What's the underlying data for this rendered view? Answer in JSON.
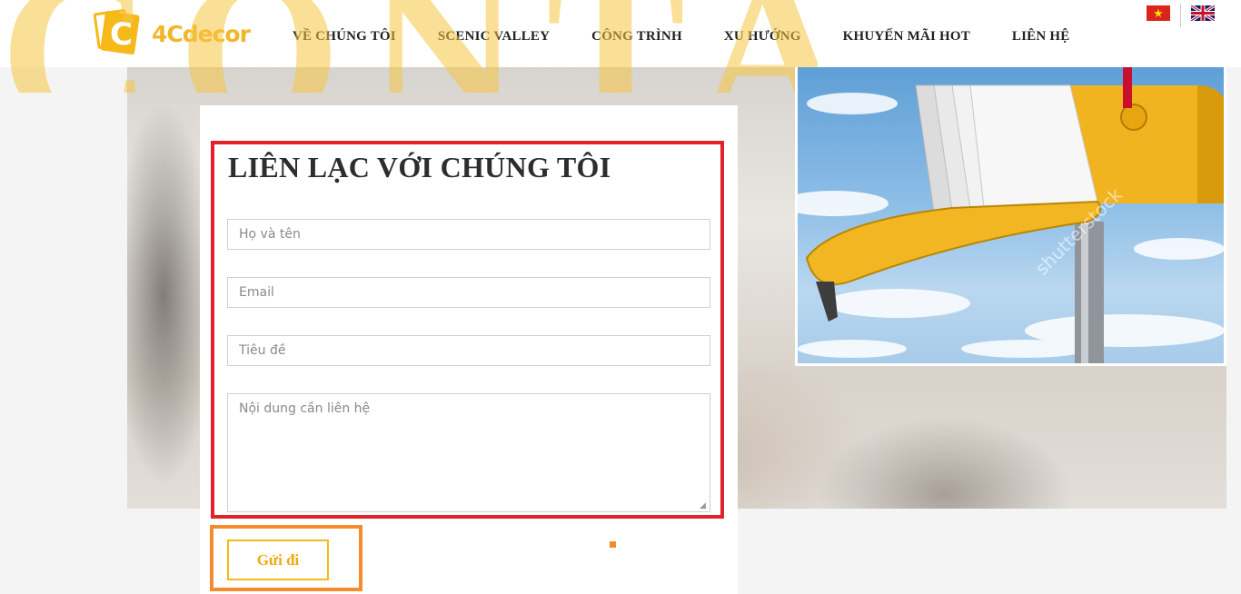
{
  "header": {
    "logo_text": "4Cdecor",
    "logo_letter": "C",
    "nav": [
      "VỀ CHÚNG TÔI",
      "SCENIC VALLEY",
      "CÔNG TRÌNH",
      "XU HƯỚNG",
      "KHUYẾN MÃI HOT",
      "LIÊN HỆ"
    ],
    "languages": [
      "vietnamese-flag-icon",
      "uk-flag-icon"
    ]
  },
  "background_text": "CONTA",
  "contact_form": {
    "title": "LIÊN LẠC VỚI CHÚNG TÔI",
    "name_placeholder": "Họ và tên",
    "email_placeholder": "Email",
    "subject_placeholder": "Tiêu đề",
    "message_placeholder": "Nội dung cần liên hệ",
    "submit_label": "Gửi đi"
  },
  "image": {
    "icon": "mailbox-photo"
  },
  "colors": {
    "brand": "#f5b919",
    "highlight_red": "#e0232a",
    "highlight_orange": "#f58b2d"
  }
}
